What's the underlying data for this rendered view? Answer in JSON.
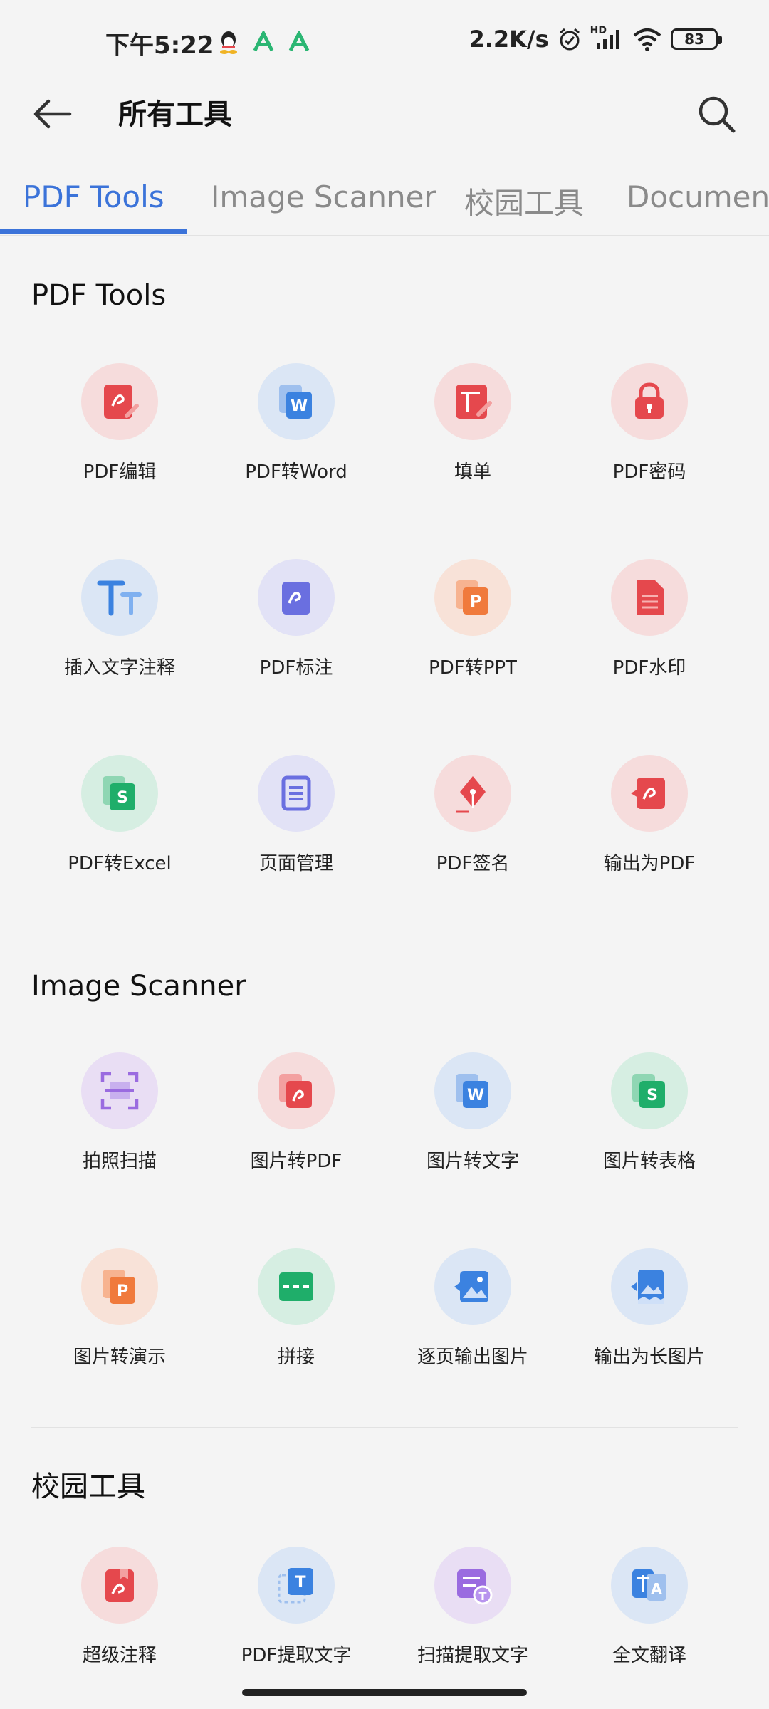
{
  "status": {
    "time": "下午5:22",
    "speed": "2.2K/s",
    "network": "HD",
    "battery": "83"
  },
  "header": {
    "title": "所有工具"
  },
  "tabs": [
    {
      "label": "PDF Tools"
    },
    {
      "label": "Image Scanner"
    },
    {
      "label": "校园工具"
    },
    {
      "label": "Document"
    }
  ],
  "sections": {
    "pdf": {
      "title": "PDF Tools",
      "tools": [
        {
          "label": "PDF编辑"
        },
        {
          "label": "PDF转Word"
        },
        {
          "label": "填单"
        },
        {
          "label": "PDF密码"
        },
        {
          "label": "插入文字注释"
        },
        {
          "label": "PDF标注"
        },
        {
          "label": "PDF转PPT"
        },
        {
          "label": "PDF水印"
        },
        {
          "label": "PDF转Excel"
        },
        {
          "label": "页面管理"
        },
        {
          "label": "PDF签名"
        },
        {
          "label": "输出为PDF"
        }
      ]
    },
    "scanner": {
      "title": "Image Scanner",
      "tools": [
        {
          "label": "拍照扫描"
        },
        {
          "label": "图片转PDF"
        },
        {
          "label": "图片转文字"
        },
        {
          "label": "图片转表格"
        },
        {
          "label": "图片转演示"
        },
        {
          "label": "拼接"
        },
        {
          "label": "逐页输出图片"
        },
        {
          "label": "输出为长图片"
        }
      ]
    },
    "campus": {
      "title": "校园工具",
      "tools": [
        {
          "label": "超级注释"
        },
        {
          "label": "PDF提取文字"
        },
        {
          "label": "扫描提取文字"
        },
        {
          "label": "全文翻译"
        }
      ]
    }
  },
  "icons": {
    "glyph_w": "W",
    "glyph_p": "P",
    "glyph_s": "S",
    "glyph_t": "T",
    "glyph_tt": "TT",
    "glyph_a": "A"
  },
  "colors": {
    "accent": "#3b73d9",
    "red": "#e5484d",
    "blue": "#3b82e0",
    "orange": "#f07a3c",
    "green": "#1fae6a",
    "indigo": "#6a6fe0",
    "purple": "#9a6be0"
  }
}
